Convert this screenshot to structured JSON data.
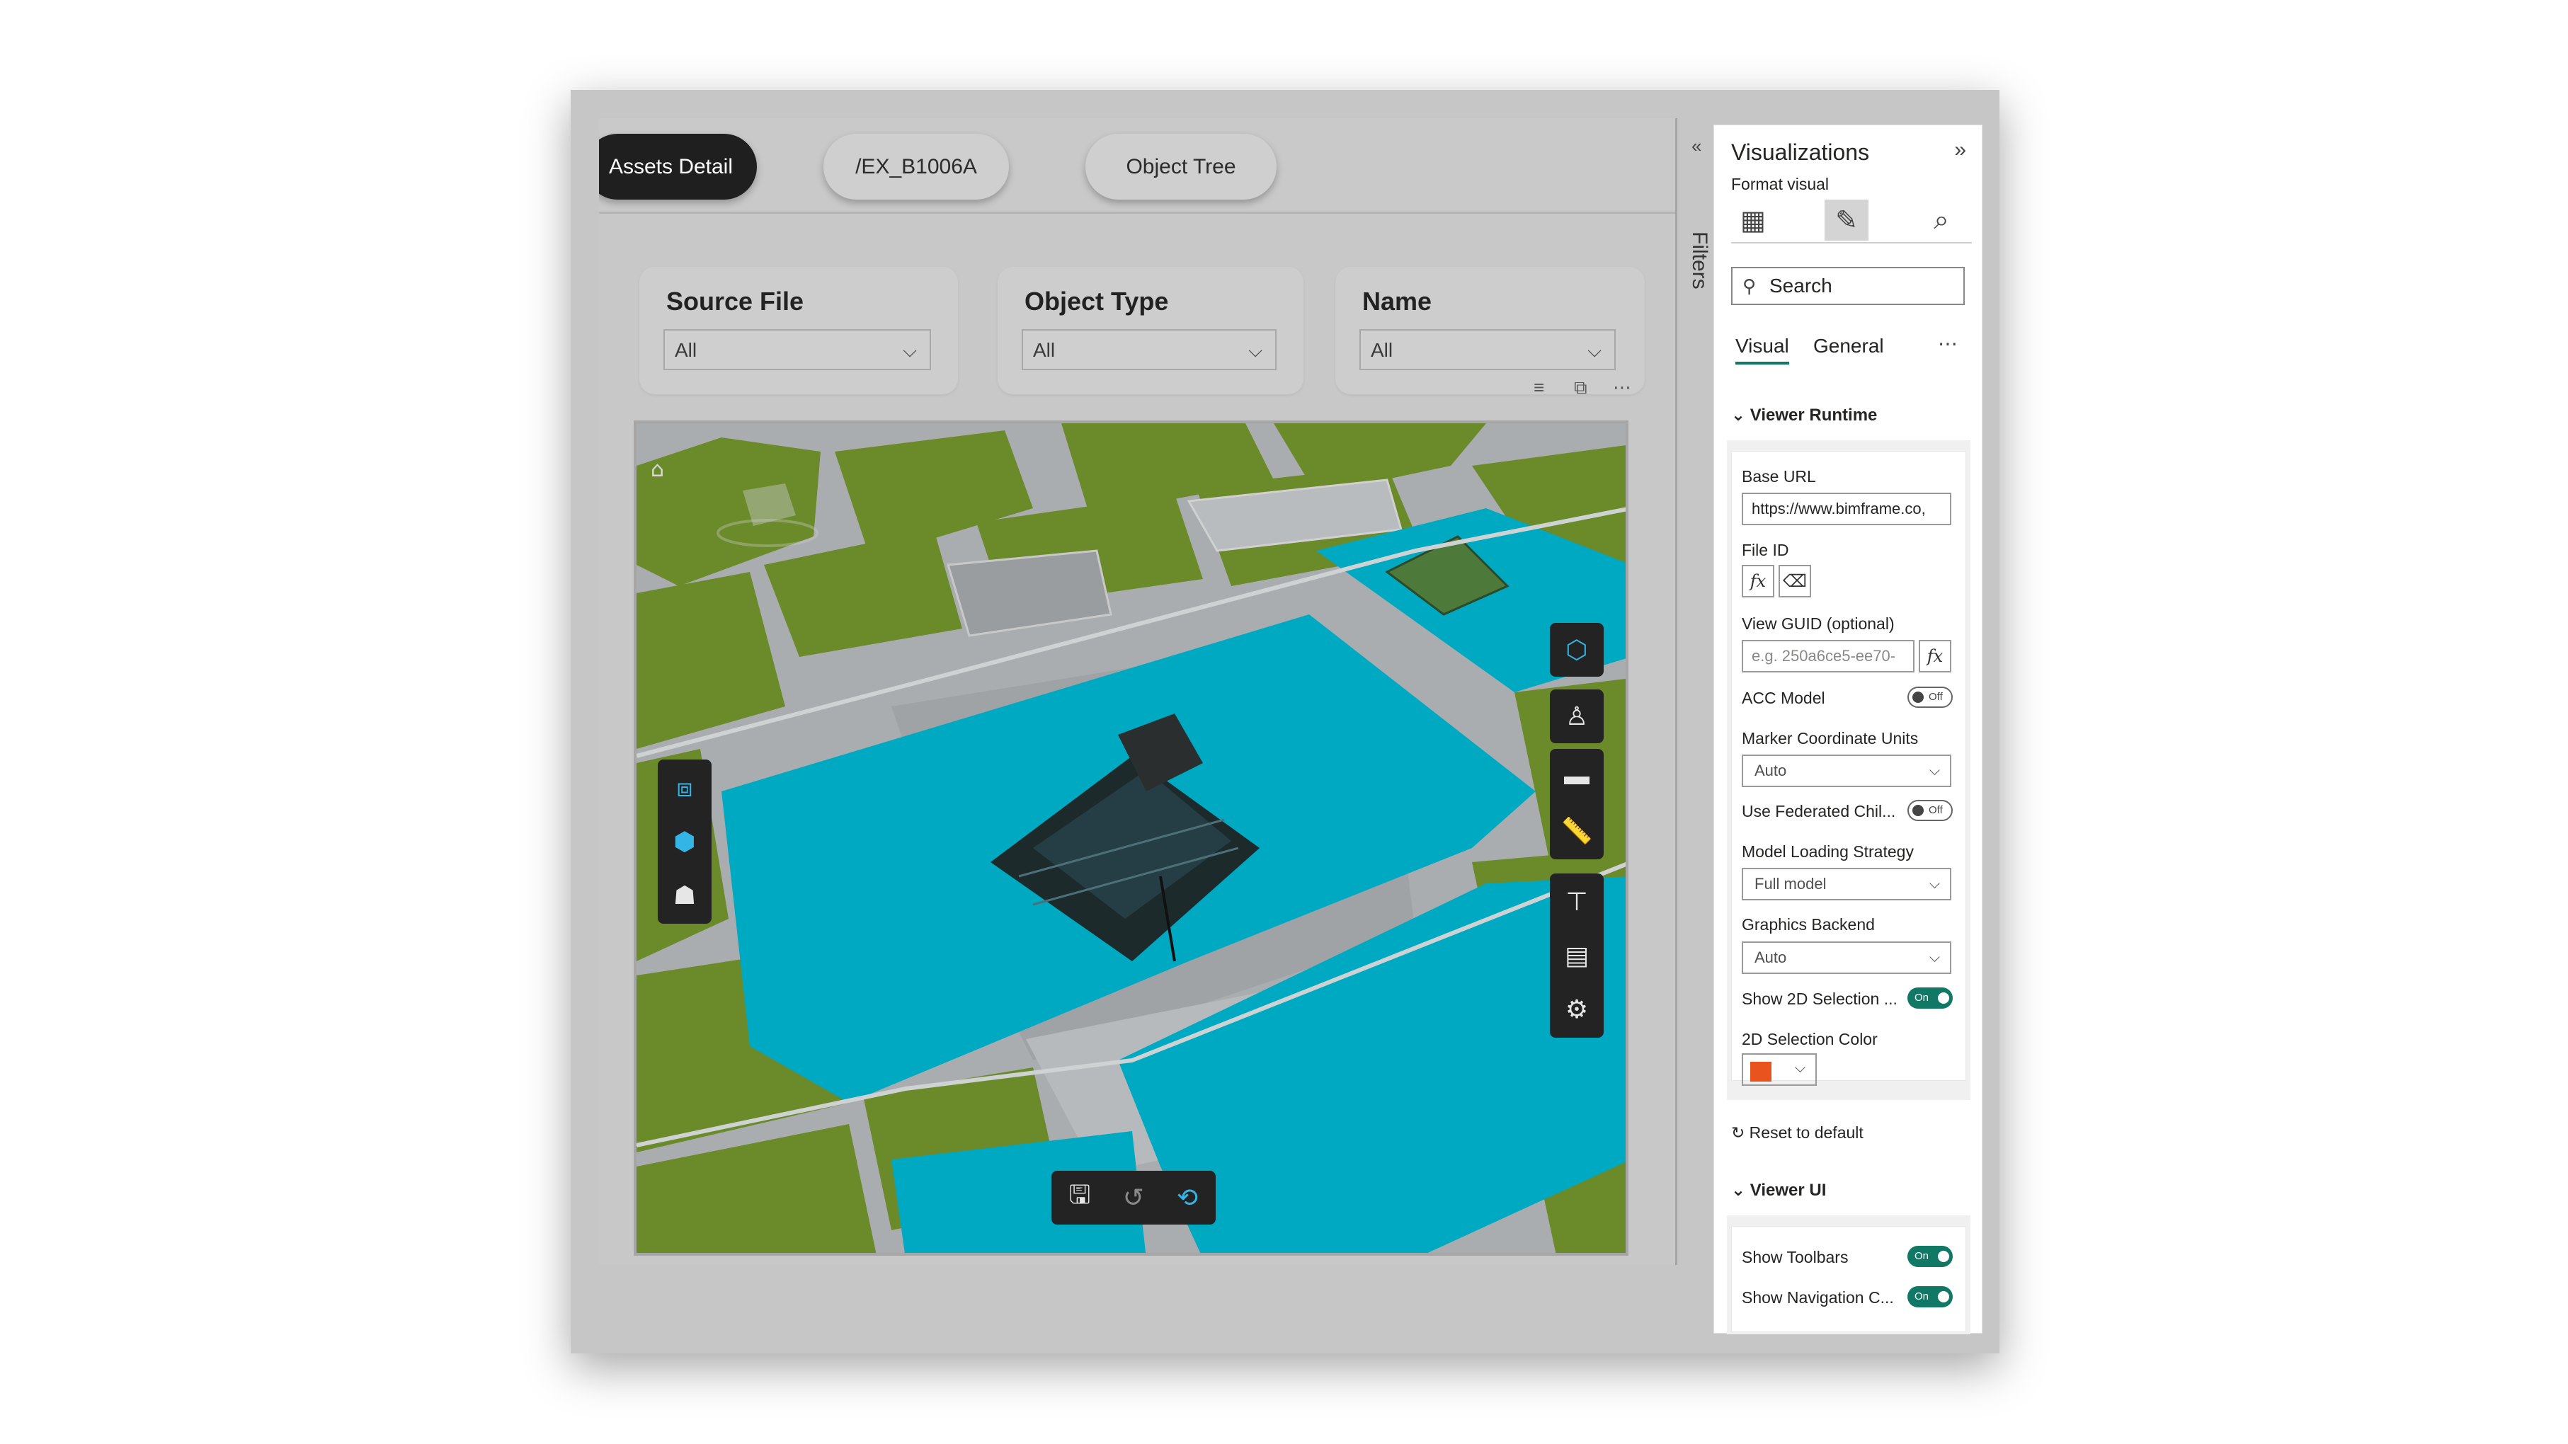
{
  "report": {
    "tabs": [
      {
        "label": "Assets Detail"
      },
      {
        "label": "/EX_B1006A"
      },
      {
        "label": "Object Tree"
      }
    ],
    "slicers": [
      {
        "title": "Source File",
        "value": "All"
      },
      {
        "title": "Object Type",
        "value": "All"
      },
      {
        "title": "Name",
        "value": "All"
      }
    ]
  },
  "filters_rail": {
    "label": "Filters"
  },
  "pane": {
    "title": "Visualizations",
    "subtitle": "Format visual",
    "search_placeholder": "Search",
    "tabs": [
      "Visual",
      "General"
    ],
    "viewer_runtime": {
      "header": "Viewer Runtime",
      "base_url_label": "Base URL",
      "base_url_value": "https://www.bimframe.co,",
      "file_id_label": "File ID",
      "view_guid_label": "View GUID (optional)",
      "view_guid_placeholder": "e.g. 250a6ce5-ee70-",
      "acc_model_label": "ACC Model",
      "acc_model_state": "Off",
      "marker_units_label": "Marker Coordinate Units",
      "marker_units_value": "Auto",
      "federated_label": "Use Federated Chil...",
      "federated_state": "Off",
      "loading_label": "Model Loading Strategy",
      "loading_value": "Full model",
      "graphics_label": "Graphics Backend",
      "graphics_value": "Auto",
      "show2d_label": "Show 2D Selection ...",
      "show2d_state": "On",
      "color2d_label": "2D Selection Color",
      "color2d_value": "#e8531e",
      "reset_label": "Reset to default"
    },
    "viewer_ui": {
      "header": "Viewer UI",
      "show_toolbars_label": "Show Toolbars",
      "show_toolbars_state": "On",
      "show_nav_label": "Show Navigation C...",
      "show_nav_state": "On"
    }
  },
  "colors": {
    "accent": "#117865",
    "water": "#00a9c2",
    "grass": "#6b8a2a",
    "road": "#a9adaf"
  }
}
